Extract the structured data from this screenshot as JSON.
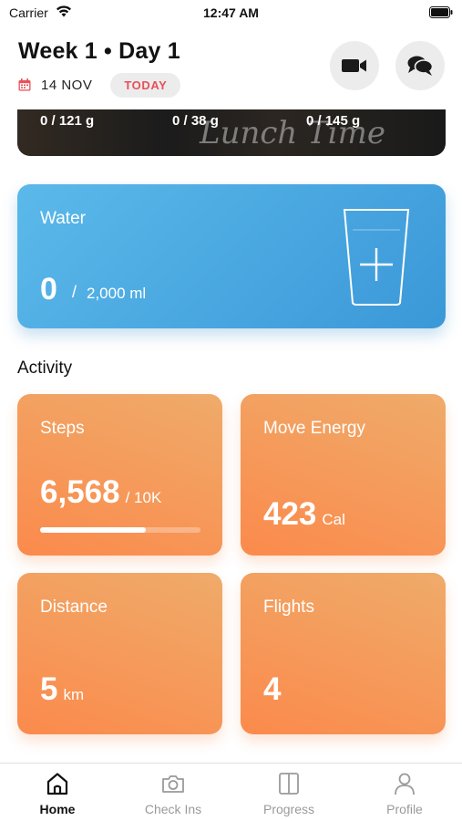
{
  "status_bar": {
    "carrier": "Carrier",
    "time": "12:47 AM",
    "icons": [
      "wifi-icon",
      "battery-icon"
    ]
  },
  "header": {
    "title": "Week 1 • Day 1",
    "date": "14 NOV",
    "today_badge": "TODAY",
    "icons": [
      "calendar-icon",
      "video-camera-icon",
      "chat-icon"
    ]
  },
  "lunch_card": {
    "macros": [
      "0 / 121 g",
      "0 / 38 g",
      "0 / 145 g"
    ],
    "script_text": "Lunch Time"
  },
  "water": {
    "label": "Water",
    "value": "0",
    "separator": "/",
    "goal": "2,000 ml",
    "icon": "water-glass-plus-icon"
  },
  "activity": {
    "heading": "Activity",
    "steps": {
      "label": "Steps",
      "value": "6,568",
      "unit": "/ 10K",
      "progress": 0.657
    },
    "move_energy": {
      "label": "Move Energy",
      "value": "423",
      "unit": "Cal"
    },
    "distance": {
      "label": "Distance",
      "value": "5",
      "unit": "km"
    },
    "flights": {
      "label": "Flights",
      "value": "4"
    }
  },
  "tab_bar": {
    "tabs": [
      {
        "label": "Home",
        "icon": "home-icon",
        "active": true
      },
      {
        "label": "Check Ins",
        "icon": "camera-icon",
        "active": false
      },
      {
        "label": "Progress",
        "icon": "progress-icon",
        "active": false
      },
      {
        "label": "Profile",
        "icon": "profile-icon",
        "active": false
      }
    ]
  },
  "colors": {
    "water_card": "#4aa9e2",
    "activity_tile": "#f59a5a",
    "today_badge_text": "#e8505b"
  }
}
